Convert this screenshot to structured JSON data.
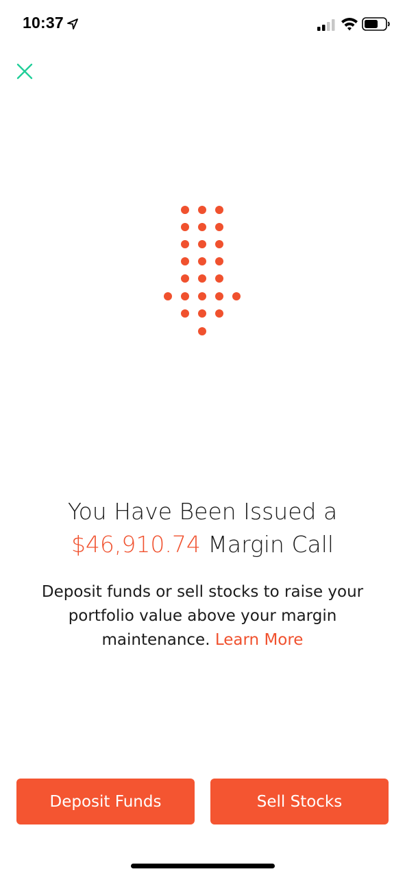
{
  "status_bar": {
    "time": "10:37",
    "icons": [
      "location-arrow-icon",
      "cellular-signal-icon",
      "wifi-icon",
      "battery-icon"
    ]
  },
  "close_icon": "close-icon",
  "graphic": {
    "icon": "down-arrow-dots-icon",
    "color": "#f0512e"
  },
  "headline": {
    "line1": "You Have Been Issued a",
    "amount": "$46,910.74",
    "line2_suffix": " Margin Call"
  },
  "body": {
    "text": "Deposit funds or sell stocks to raise your portfolio value above your margin maintenance. ",
    "link": "Learn More"
  },
  "buttons": {
    "deposit": "Deposit Funds",
    "sell": "Sell Stocks"
  },
  "colors": {
    "accent": "#f0512e",
    "button": "#f45531",
    "close": "#21ce99"
  }
}
